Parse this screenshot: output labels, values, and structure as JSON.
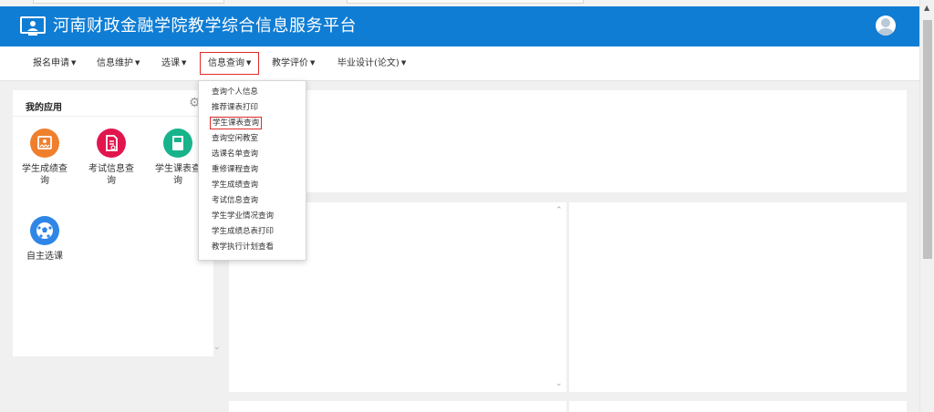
{
  "header": {
    "title": "河南财政金融学院教学综合信息服务平台",
    "logo_icon": "monitor-user-icon",
    "avatar_icon": "user-avatar-icon",
    "bg_color": "#0f7dd4"
  },
  "nav": {
    "items": [
      {
        "label": "报名申请"
      },
      {
        "label": "信息维护"
      },
      {
        "label": "选课"
      },
      {
        "label": "信息查询",
        "active": true
      },
      {
        "label": "教学评价"
      },
      {
        "label": "毕业设计(论文)"
      }
    ]
  },
  "dropdown": {
    "items": [
      {
        "label": "查询个人信息"
      },
      {
        "label": "推荐课表打印"
      },
      {
        "label": "学生课表查询",
        "highlighted": true
      },
      {
        "label": "查询空闲教室"
      },
      {
        "label": "选课名单查询"
      },
      {
        "label": "重修课程查询"
      },
      {
        "label": "学生成绩查询"
      },
      {
        "label": "考试信息查询"
      },
      {
        "label": "学生学业情况查询"
      },
      {
        "label": "学生成绩总表打印"
      },
      {
        "label": "教学执行计划查看"
      }
    ],
    "highlight_color": "#e02a2a"
  },
  "apps": {
    "title": "我的应用",
    "settings_icon": "gear-icon",
    "items": [
      {
        "label_line1": "学生成绩查",
        "label_line2": "询",
        "icon": "certificate-icon",
        "color": "#f07f2d"
      },
      {
        "label_line1": "考试信息查",
        "label_line2": "询",
        "icon": "document-icon",
        "color": "#e2164f"
      },
      {
        "label_line1": "学生课表查",
        "label_line2": "询",
        "icon": "book-icon",
        "color": "#18b38a"
      },
      {
        "label_line1": "自主选课",
        "label_line2": "",
        "icon": "soccer-ball-icon",
        "color": "#2f86e6"
      }
    ]
  }
}
